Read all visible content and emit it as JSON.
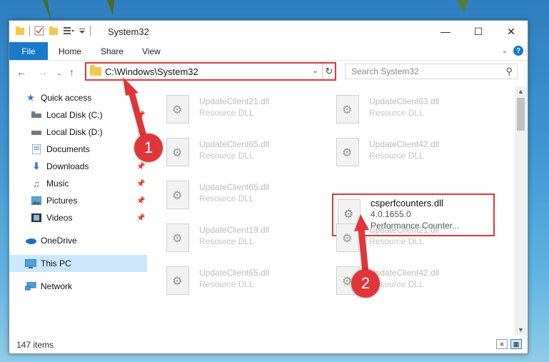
{
  "window": {
    "title": "System32"
  },
  "ribbon": {
    "tabs": [
      "File",
      "Home",
      "Share",
      "View"
    ]
  },
  "address": {
    "path": "C:\\Windows\\System32"
  },
  "search": {
    "placeholder": "Search System32"
  },
  "sidebar": {
    "items": [
      {
        "label": "Quick access",
        "icon": "star-icon"
      },
      {
        "label": "Local Disk (C:)",
        "icon": "drive-icon"
      },
      {
        "label": "Local Disk (D:)",
        "icon": "drive-icon"
      },
      {
        "label": "Documents",
        "icon": "documents-icon"
      },
      {
        "label": "Downloads",
        "icon": "download-icon"
      },
      {
        "label": "Music",
        "icon": "music-icon"
      },
      {
        "label": "Pictures",
        "icon": "pictures-icon"
      },
      {
        "label": "Videos",
        "icon": "videos-icon"
      },
      {
        "label": "OneDrive",
        "icon": "cloud-icon"
      },
      {
        "label": "This PC",
        "icon": "computer-icon"
      },
      {
        "label": "Network",
        "icon": "network-icon"
      }
    ]
  },
  "files": [
    {
      "name": "UpdateClient21.dll",
      "type": "Resource DLL"
    },
    {
      "name": "UpdateClient63.dll",
      "type": "Resource DLL"
    },
    {
      "name": "UpdateClient65.dll",
      "type": "Resource DLL"
    },
    {
      "name": "UpdateClient42.dll",
      "type": "Resource DLL"
    },
    {
      "name": "UpdateClient65.dll",
      "type": "Resource DLL"
    },
    {
      "name": "UpdateClient19.dll",
      "type": "Resource DLL"
    },
    {
      "name": "UpdateClient21.dll",
      "type": "Resource DLL"
    },
    {
      "name": "UpdateClient65.dll",
      "type": "Resource DLL"
    },
    {
      "name": "UpdateClient42.dll",
      "type": "Resource DLL"
    }
  ],
  "highlighted_file": {
    "name": "csperfcounters.dll",
    "version": "4.0.1655.0",
    "description": "Performance Counter..."
  },
  "status": {
    "count": "147 items"
  },
  "annotations": {
    "one": "1",
    "two": "2"
  },
  "colors": {
    "accent": "#1979ca",
    "annotation": "#e0363a",
    "selected": "#cce8ff"
  }
}
